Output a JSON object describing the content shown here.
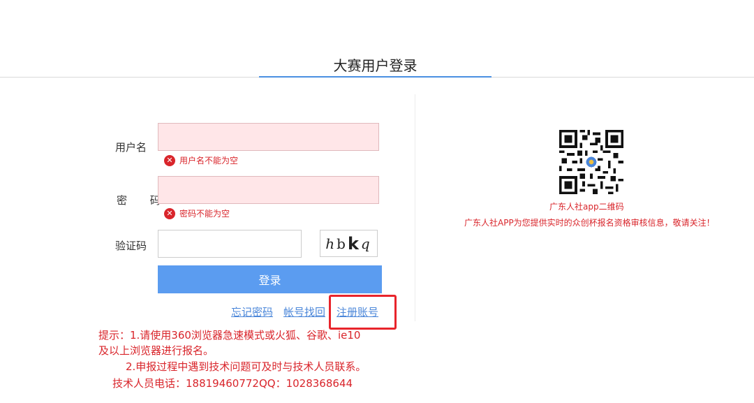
{
  "header": {
    "title": "大赛用户登录"
  },
  "form": {
    "username": {
      "label": "用户名",
      "value": "",
      "error": "用户名不能为空"
    },
    "password": {
      "label": "密 码",
      "value": "",
      "error": "密码不能为空"
    },
    "captcha": {
      "label": "验证码",
      "value": "",
      "image_chars": [
        "h",
        "b",
        "k",
        "q"
      ]
    },
    "login_label": "登录"
  },
  "links": {
    "forgot_password": "忘记密码",
    "recover_account": "帐号找回",
    "register": "注册账号"
  },
  "notice": {
    "line1": "提示：1.请使用360浏览器急速模式或火狐、谷歌、ie10",
    "line2": "及以上浏览器进行报名。",
    "line3": "2.申报过程中遇到技术问题可及时与技术人员联系。",
    "line4": "技术人员电话：18819460772QQ：1028368644"
  },
  "qr": {
    "caption": "广东人社app二维码",
    "description": "广东人社APP为您提供实时的众创杯报名资格审核信息，敬请关注！"
  },
  "colors": {
    "error": "#d9252b",
    "accent": "#5b9cf0",
    "link": "#4a86d9",
    "highlight": "#e8242b",
    "input_error_bg": "#ffe6e8"
  },
  "icons": {
    "error": "x-circle-icon",
    "qr": "qr-code"
  }
}
